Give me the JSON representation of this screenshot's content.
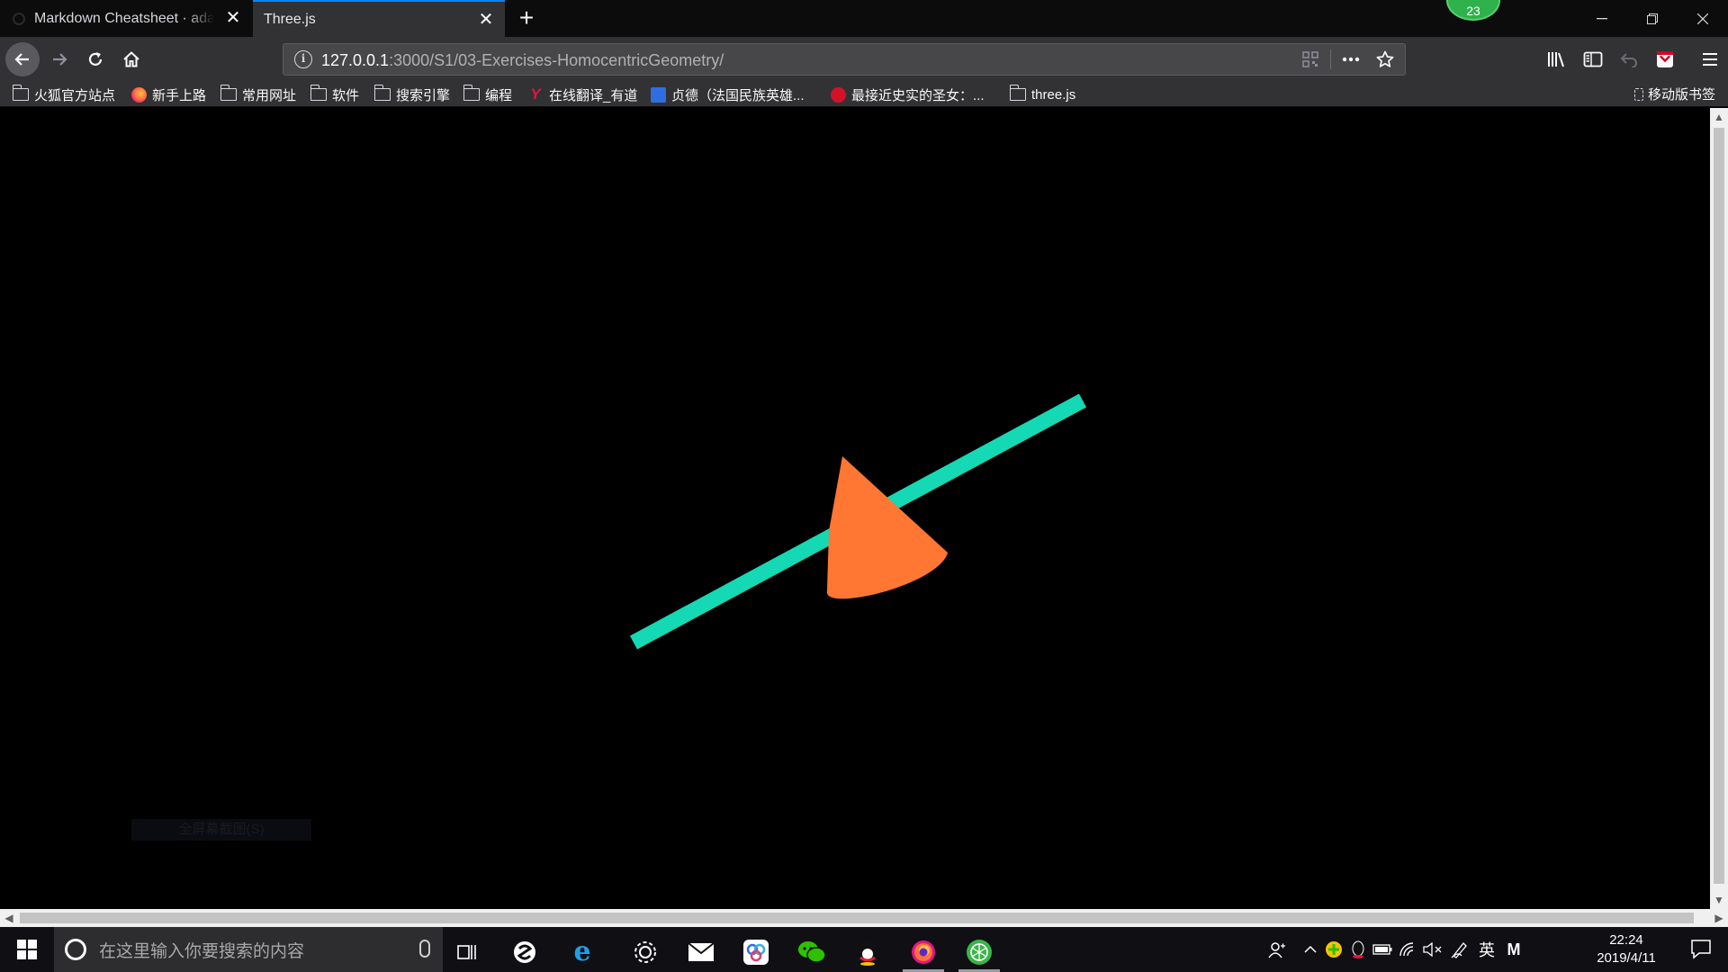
{
  "tabs": [
    {
      "title": "Markdown Cheatsheet · adam-p/markdown-here Wiki",
      "active": false
    },
    {
      "title": "Three.js",
      "active": true
    }
  ],
  "badge_count": "23",
  "urlbar": {
    "host": "127.0.0.1",
    "rest": ":3000/S1/03-Exercises-HomocentricGeometry/"
  },
  "bookmarks": [
    {
      "label": "火狐官方站点",
      "icon": "folder-icon"
    },
    {
      "label": "新手上路",
      "icon": "firefox-icon"
    },
    {
      "label": "常用网址",
      "icon": "folder-icon"
    },
    {
      "label": "软件",
      "icon": "folder-icon"
    },
    {
      "label": "搜索引擎",
      "icon": "folder-icon"
    },
    {
      "label": "编程",
      "icon": "folder-icon"
    },
    {
      "label": "在线翻译_有道",
      "icon": "youdao-icon"
    },
    {
      "label": "贞德（法国民族英雄...",
      "icon": "baidu-icon"
    },
    {
      "label": "最接近史实的圣女：...",
      "icon": "sina-icon"
    },
    {
      "label": "three.js",
      "icon": "folder-icon"
    }
  ],
  "mobile_bookmarks": "移动版书签",
  "scene": {
    "background": "#000000",
    "line_color": "#14d9b4",
    "cone_color": "#ff7733"
  },
  "capture_hint": "全屏幕截图(S)",
  "taskbar": {
    "search_placeholder": "在这里输入你要搜索的内容",
    "ime_label": "英",
    "ime_mode": "M",
    "time": "22:24",
    "date": "2019/4/11"
  }
}
